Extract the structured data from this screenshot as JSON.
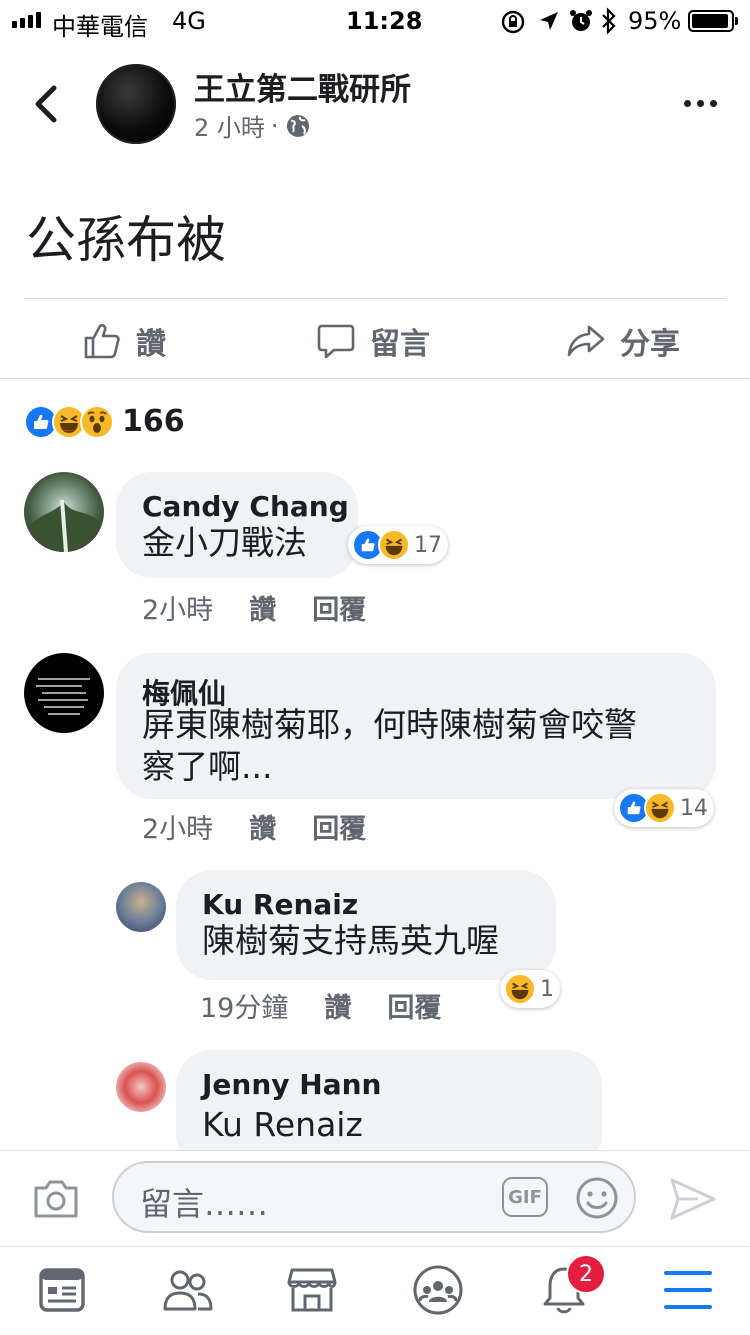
{
  "status_bar": {
    "carrier": "中華電信",
    "network": "4G",
    "time": "11:28",
    "battery": "95%"
  },
  "header": {
    "page_name": "王立第二戰研所",
    "post_age": "2 小時",
    "separator": "·",
    "privacy_icon": "globe-icon"
  },
  "post": {
    "text": "公孫布被",
    "actions": {
      "like": "讚",
      "comment": "留言",
      "share": "分享"
    },
    "reaction_count": "166"
  },
  "comments": [
    {
      "author": "Candy Chang",
      "text": "金小刀戰法",
      "time": "2小時",
      "like_label": "讚",
      "reply_label": "回覆",
      "reactions": "17"
    },
    {
      "author": "梅佩仙",
      "text_line1": "屏東陳樹菊耶，何時陳樹菊會咬警",
      "text_line2": "察了啊...",
      "time": "2小時",
      "like_label": "讚",
      "reply_label": "回覆",
      "reactions": "14"
    },
    {
      "author": "Ku Renaiz",
      "text": "陳樹菊支持馬英九喔",
      "time": "19分鐘",
      "like_label": "讚",
      "reply_label": "回覆",
      "reactions": "1"
    },
    {
      "author": "Jenny Hann",
      "text": "Ku Renaiz"
    }
  ],
  "composer": {
    "placeholder": "留言……",
    "gif_label": "GIF"
  },
  "tabbar": {
    "notifications_badge": "2"
  },
  "colors": {
    "accent": "#1877f2",
    "haha": "#f7b928",
    "badge": "#e41e3f",
    "bubble": "#f0f2f5"
  }
}
